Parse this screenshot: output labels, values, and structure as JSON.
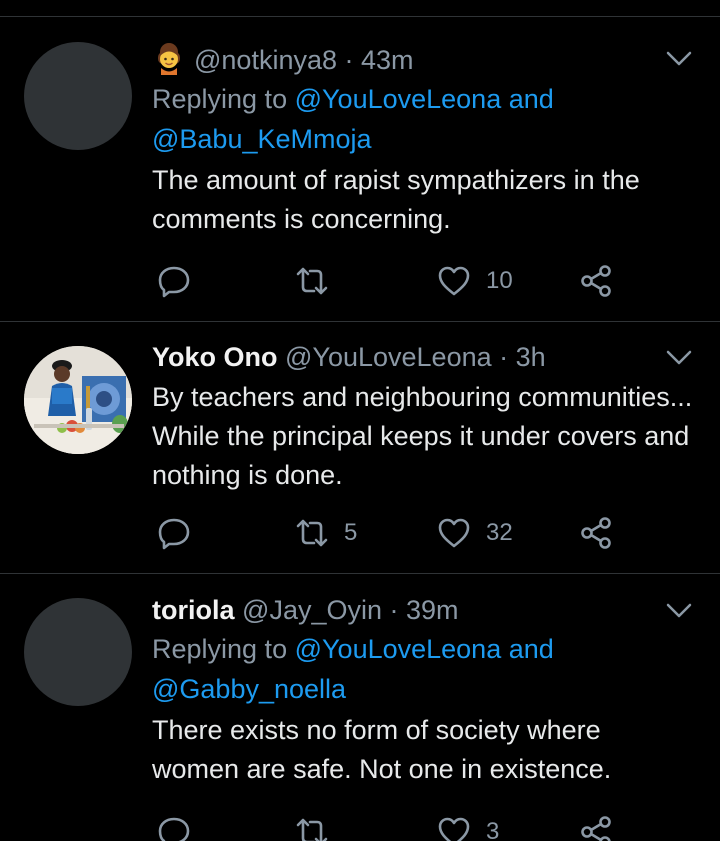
{
  "colors": {
    "background": "#000000",
    "link": "#1d9bf0",
    "muted": "#8b98a5",
    "text": "#e7e9ea"
  },
  "tweets": [
    {
      "author_emoji_icon": "girl-emoji",
      "handle": "@notkinya8",
      "time": "· 43m",
      "reply_prefix": "Replying to",
      "reply_mention_1": "@YouLoveLeona",
      "reply_and": "and",
      "reply_mention_2": "@Babu_KeMmoja",
      "text": "The amount of rapist sympathizers in the comments is concerning.",
      "retweets": "",
      "likes": "10"
    },
    {
      "name": "Yoko Ono",
      "handle": "@YouLoveLeona",
      "time": "· 3h",
      "text": "By teachers and neighbouring communities... While the principal keeps it under covers and nothing is done.",
      "retweets": "5",
      "likes": "32"
    },
    {
      "name": "toriola",
      "handle": "@Jay_Oyin",
      "time": "· 39m",
      "reply_prefix": "Replying to",
      "reply_mention_1": "@YouLoveLeona",
      "reply_and": "and",
      "reply_mention_2": "@Gabby_noella",
      "text": "There exists no form of society where women are safe. Not one in existence.",
      "retweets": "",
      "likes": "3"
    }
  ]
}
